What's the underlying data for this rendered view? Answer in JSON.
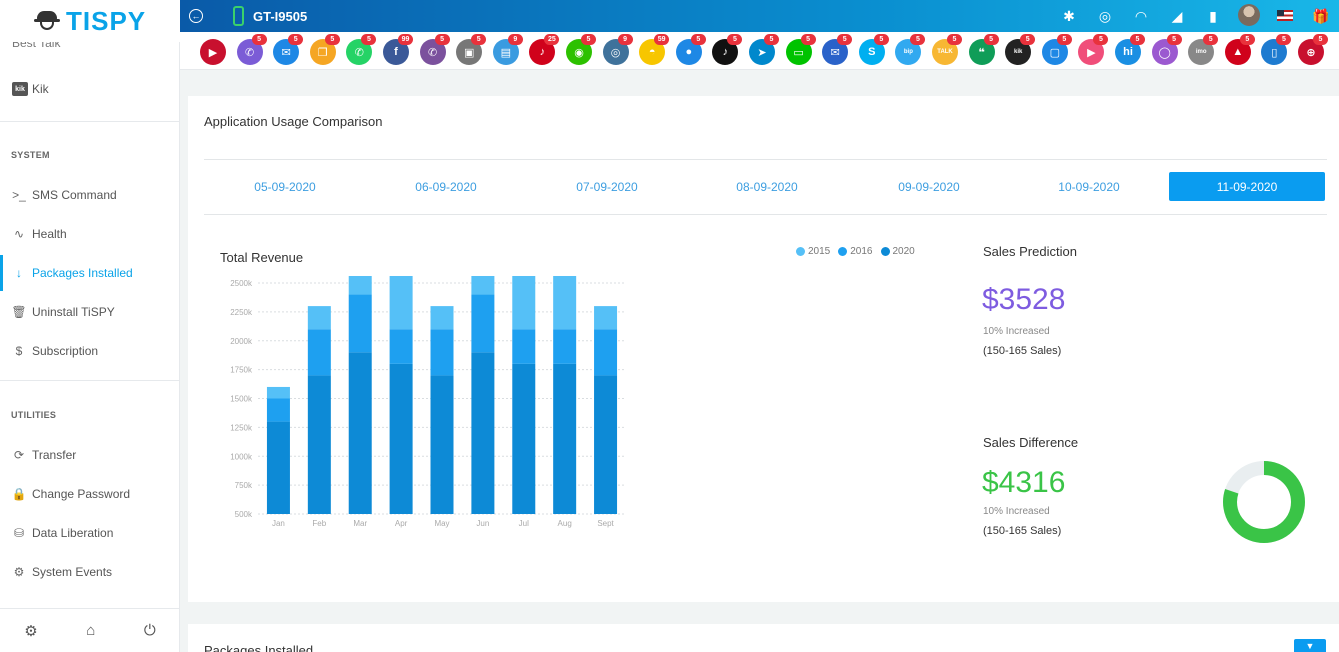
{
  "brand": {
    "name": "TISPY"
  },
  "sidebar": {
    "partial_item": "Best Talk",
    "kik": {
      "icon": "kik",
      "label": "Kik"
    },
    "sections": [
      {
        "heading": "SYSTEM",
        "items": [
          "SMS Command",
          "Health",
          "Packages Installed",
          "Uninstall TiSPY",
          "Subscription"
        ]
      },
      {
        "heading": "UTILITIES",
        "items": [
          "Transfer",
          "Change Password",
          "Data Liberation",
          "System Events"
        ]
      }
    ],
    "active_item": "Packages Installed"
  },
  "topbar": {
    "device": "GT-I9505"
  },
  "apps": [
    {
      "name": "video-camera",
      "badge": "",
      "color": "#c8102e",
      "glyph": "▶"
    },
    {
      "name": "viber-phone",
      "badge": "5",
      "color": "#7b5cd6",
      "glyph": "✆"
    },
    {
      "name": "email",
      "badge": "5",
      "color": "#1e88e5",
      "glyph": "✉"
    },
    {
      "name": "copy",
      "badge": "5",
      "color": "#f5a623",
      "glyph": "❐"
    },
    {
      "name": "whatsapp",
      "badge": "5",
      "color": "#25d366",
      "glyph": "✆"
    },
    {
      "name": "facebook",
      "badge": "99",
      "color": "#3b5998",
      "glyph": "f"
    },
    {
      "name": "viber",
      "badge": "5",
      "color": "#7b519d",
      "glyph": "✆"
    },
    {
      "name": "briefcase",
      "badge": "5",
      "color": "#777",
      "glyph": "▣"
    },
    {
      "name": "messages",
      "badge": "9",
      "color": "#3a9be0",
      "glyph": "▤"
    },
    {
      "name": "tiktok-red",
      "badge": "25",
      "color": "#d0021b",
      "glyph": "♪"
    },
    {
      "name": "wechat",
      "badge": "5",
      "color": "#2dc100",
      "glyph": "◉"
    },
    {
      "name": "instagram",
      "badge": "9",
      "color": "#3f729b",
      "glyph": "◎"
    },
    {
      "name": "snapchat",
      "badge": "59",
      "color": "#f7c600",
      "glyph": "◓"
    },
    {
      "name": "flickr",
      "badge": "5",
      "color": "#1e88e5",
      "glyph": "●"
    },
    {
      "name": "tiktok",
      "badge": "5",
      "color": "#111",
      "glyph": "♪"
    },
    {
      "name": "telegram",
      "badge": "5",
      "color": "#0088cc",
      "glyph": "➤"
    },
    {
      "name": "line",
      "badge": "5",
      "color": "#00c300",
      "glyph": "▭"
    },
    {
      "name": "messenger",
      "badge": "5",
      "color": "#2a62c9",
      "glyph": "✉"
    },
    {
      "name": "skype",
      "badge": "5",
      "color": "#00aff0",
      "glyph": "S"
    },
    {
      "name": "bip",
      "badge": "5",
      "color": "#31a9f0",
      "glyph": "bip"
    },
    {
      "name": "talk",
      "badge": "5",
      "color": "#f7b733",
      "glyph": "TALK"
    },
    {
      "name": "hangouts",
      "badge": "5",
      "color": "#0f9d58",
      "glyph": "❝"
    },
    {
      "name": "kik",
      "badge": "5",
      "color": "#222",
      "glyph": "kik"
    },
    {
      "name": "chat-box",
      "badge": "5",
      "color": "#1e88e5",
      "glyph": "▢"
    },
    {
      "name": "video-chat",
      "badge": "5",
      "color": "#f04e7a",
      "glyph": "▶"
    },
    {
      "name": "hike",
      "badge": "5",
      "color": "#1a8fe3",
      "glyph": "hi"
    },
    {
      "name": "signal",
      "badge": "5",
      "color": "#9b59d0",
      "glyph": "◯"
    },
    {
      "name": "imo",
      "badge": "5",
      "color": "#888",
      "glyph": "imo"
    },
    {
      "name": "gallery",
      "badge": "5",
      "color": "#d0021b",
      "glyph": "▲"
    },
    {
      "name": "mobile",
      "badge": "5",
      "color": "#1e7bd0",
      "glyph": "▯"
    },
    {
      "name": "web",
      "badge": "5",
      "color": "#c8102e",
      "glyph": "⊕"
    }
  ],
  "card": {
    "title": "Application Usage Comparison",
    "dates": [
      "05-09-2020",
      "06-09-2020",
      "07-09-2020",
      "08-09-2020",
      "09-09-2020",
      "10-09-2020",
      "11-09-2020"
    ],
    "active_date": "11-09-2020"
  },
  "chart_data": {
    "type": "bar",
    "stacked": true,
    "title": "Total Revenue",
    "categories": [
      "Jan",
      "Feb",
      "Mar",
      "Apr",
      "May",
      "Jun",
      "Jul",
      "Aug",
      "Sept"
    ],
    "series": [
      {
        "name": "2020",
        "color": "#0d8ad6",
        "values": [
          800,
          1200,
          1400,
          1300,
          1200,
          1400,
          1300,
          1300,
          1200
        ]
      },
      {
        "name": "2016",
        "color": "#1ea0f0",
        "values": [
          200,
          400,
          500,
          300,
          400,
          500,
          300,
          300,
          400
        ]
      },
      {
        "name": "2015",
        "color": "#55c0f7",
        "values": [
          100,
          200,
          400,
          600,
          200,
          400,
          600,
          600,
          200
        ]
      }
    ],
    "legend_order": [
      "2015",
      "2016",
      "2020"
    ],
    "ylim": [
      500,
      2500
    ],
    "yticks": [
      "500k",
      "750k",
      "1000k",
      "1250k",
      "1500k",
      "1750k",
      "2000k",
      "2250k",
      "2500k"
    ],
    "grid": true,
    "legend": "top-right"
  },
  "prediction": {
    "title": "Sales Prediction",
    "value": "$3528",
    "change": "10% Increased",
    "range": "(150-165 Sales)"
  },
  "difference": {
    "title": "Sales Difference",
    "value": "$4316",
    "change": "10% Increased",
    "range": "(150-165 Sales)",
    "donut_fraction": 0.8,
    "donut_color": "#3ac447"
  },
  "packages": {
    "title": "Packages Installed"
  }
}
